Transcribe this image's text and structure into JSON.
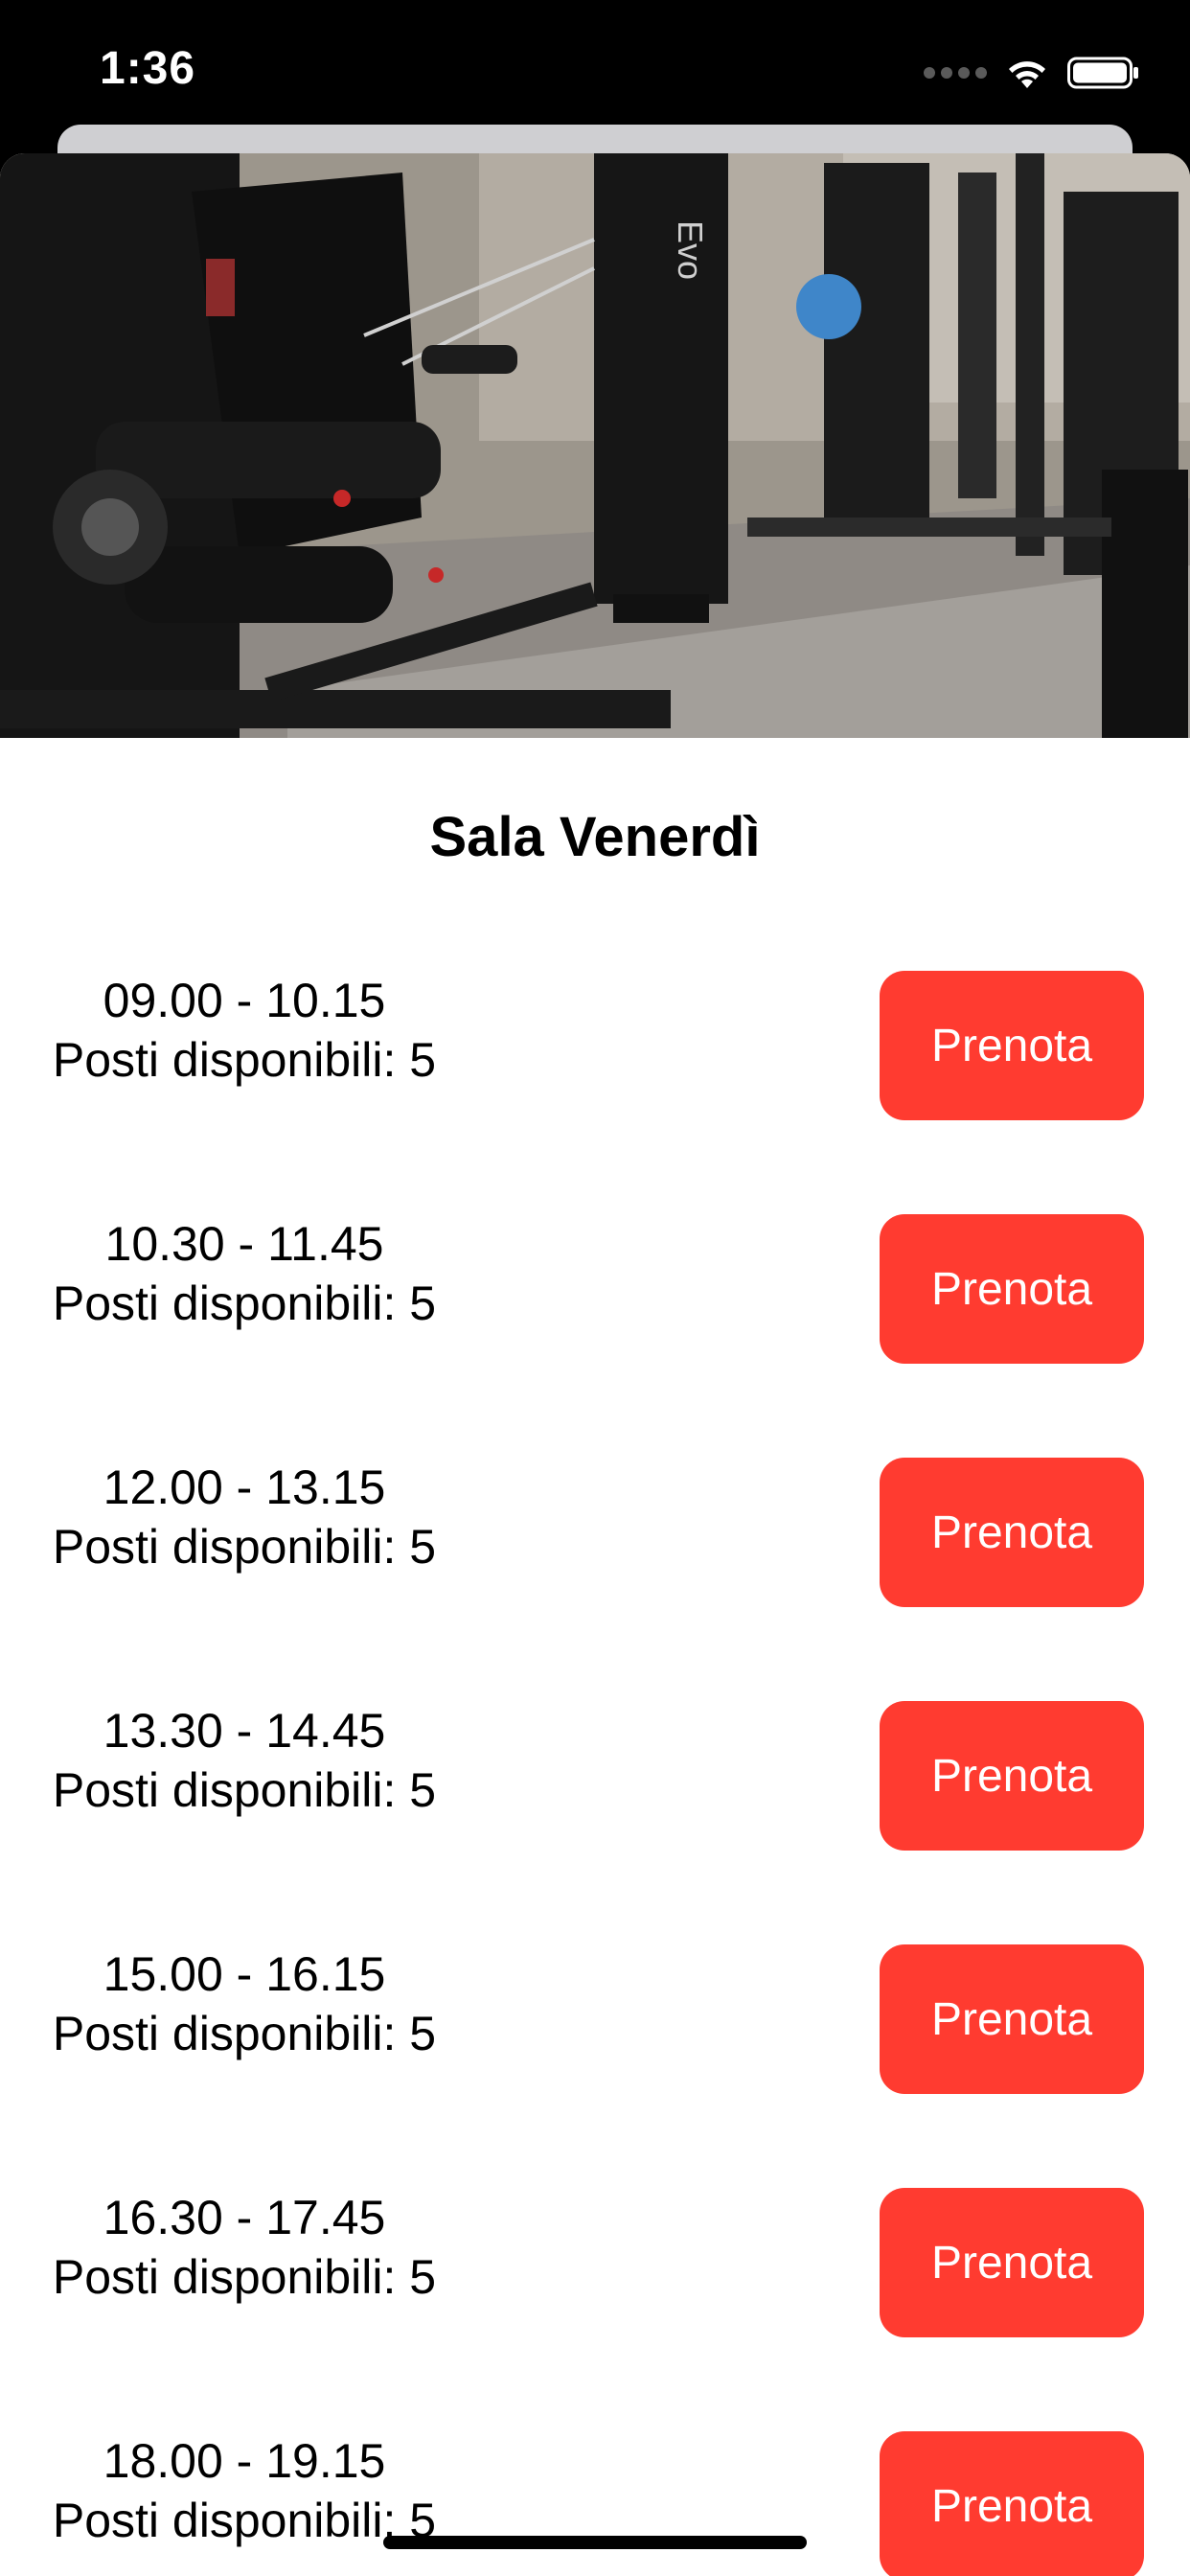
{
  "status_bar": {
    "time": "1:36",
    "icons": [
      "signal-dots-icon",
      "wifi-icon",
      "battery-icon"
    ]
  },
  "hero_image": {
    "description_icon": "gym-photo-icon",
    "wall_text": "Evo"
  },
  "page": {
    "title": "Sala Venerdì"
  },
  "slots": [
    {
      "time": "09.00 - 10.15",
      "seats": "Posti disponibili: 5",
      "button": "Prenota"
    },
    {
      "time": "10.30 - 11.45",
      "seats": "Posti disponibili: 5",
      "button": "Prenota"
    },
    {
      "time": "12.00 - 13.15",
      "seats": "Posti disponibili: 5",
      "button": "Prenota"
    },
    {
      "time": "13.30 - 14.45",
      "seats": "Posti disponibili: 5",
      "button": "Prenota"
    },
    {
      "time": "15.00 - 16.15",
      "seats": "Posti disponibili: 5",
      "button": "Prenota"
    },
    {
      "time": "16.30 - 17.45",
      "seats": "Posti disponibili: 5",
      "button": "Prenota"
    },
    {
      "time": "18.00 - 19.15",
      "seats": "Posti disponibili: 5",
      "button": "Prenota"
    }
  ],
  "colors": {
    "accent": "#ff3b30",
    "background": "#ffffff",
    "status_bar": "#000000"
  }
}
